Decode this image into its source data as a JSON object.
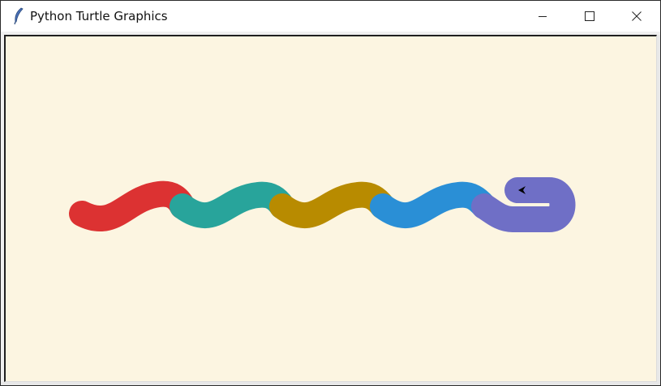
{
  "window": {
    "title": "Python Turtle Graphics",
    "app_icon": "feather-icon",
    "controls": {
      "minimize_icon": "minimize-icon",
      "maximize_icon": "maximize-icon",
      "close_icon": "close-icon"
    }
  },
  "canvas": {
    "background": "#fcf5e1",
    "snake": {
      "segments": [
        {
          "color": "#dc3232"
        },
        {
          "color": "#28a49b"
        },
        {
          "color": "#b88b00"
        },
        {
          "color": "#2a8fd6"
        },
        {
          "color": "#6f6fc6"
        }
      ]
    },
    "turtle_icon": "turtle-arrow-icon",
    "turtle_color": "#000000"
  }
}
